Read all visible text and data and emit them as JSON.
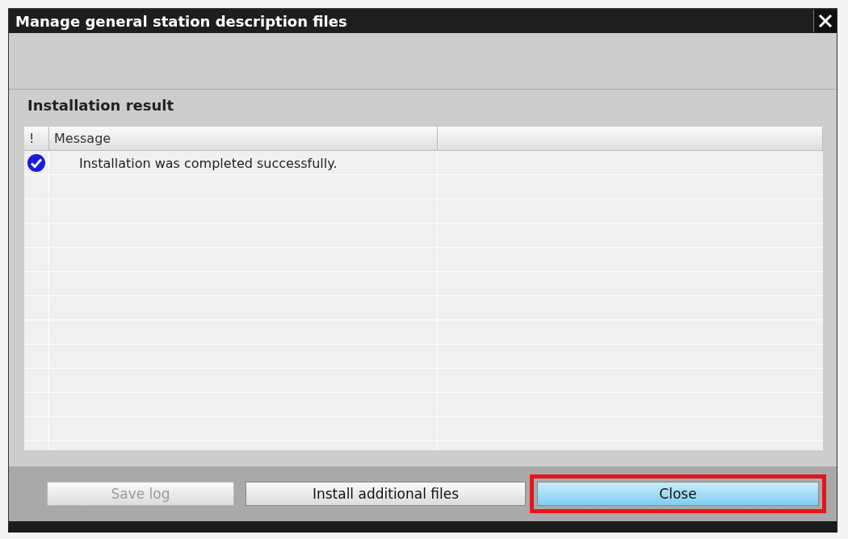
{
  "window": {
    "title": "Manage general station description files"
  },
  "section_title": "Installation result",
  "table": {
    "columns": [
      "!",
      "Message"
    ],
    "rows": [
      {
        "kind": "success",
        "message": "Installation was completed successfully."
      }
    ]
  },
  "buttons": [
    {
      "label": "Save log",
      "disabled": true,
      "selected": false,
      "highlighted": false
    },
    {
      "label": "Install additional files",
      "disabled": false,
      "selected": false,
      "highlighted": false
    },
    {
      "label": "Close",
      "disabled": false,
      "selected": true,
      "highlighted": true
    }
  ]
}
